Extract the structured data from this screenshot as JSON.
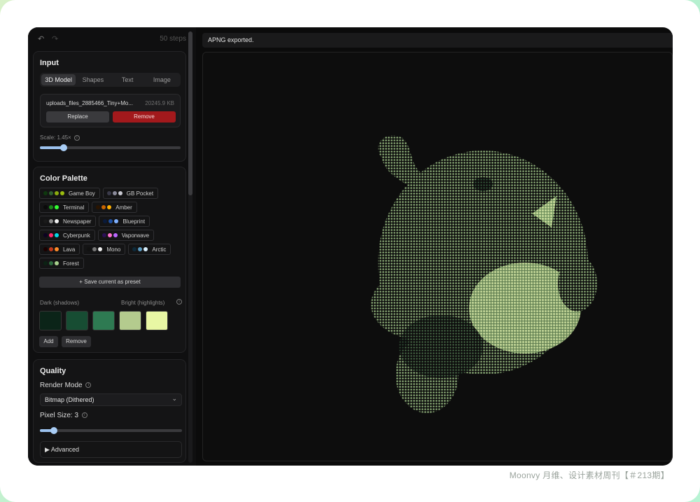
{
  "toolbar": {
    "undo": "↶",
    "redo": "↷",
    "steps": "50 steps"
  },
  "input": {
    "title": "Input",
    "tabs": [
      "3D Model",
      "Shapes",
      "Text",
      "Image"
    ],
    "file": {
      "name": "uploads_files_2885466_Tiny+Mo...",
      "size": "20245.9 KB"
    },
    "replace": "Replace",
    "remove": "Remove",
    "scale_label": "Scale: 1.45×",
    "scale_value": 0.17
  },
  "palette": {
    "title": "Color Palette",
    "presets": [
      {
        "name": "Game Boy",
        "colors": [
          "#0f380f",
          "#306230",
          "#8bac0f",
          "#9bbc0f"
        ]
      },
      {
        "name": "GB Pocket",
        "colors": [
          "#3a3a4a",
          "#8a8a9a",
          "#c8c8d0"
        ]
      },
      {
        "name": "Terminal",
        "colors": [
          "#0a0a0a",
          "#1a8a1a",
          "#33ff33"
        ]
      },
      {
        "name": "Amber",
        "colors": [
          "#2a1400",
          "#c86400",
          "#ffb000"
        ]
      },
      {
        "name": "Newspaper",
        "colors": [
          "#1a1a1a",
          "#8a8a8a",
          "#f0f0f0"
        ]
      },
      {
        "name": "Blueprint",
        "colors": [
          "#0a1a3a",
          "#1e4fa0",
          "#7fb0ff"
        ]
      },
      {
        "name": "Cyberpunk",
        "colors": [
          "#0d0221",
          "#ff2a6d",
          "#05d9e8"
        ]
      },
      {
        "name": "Vaporwave",
        "colors": [
          "#2b1055",
          "#ff71ce",
          "#b967ff"
        ]
      },
      {
        "name": "Lava",
        "colors": [
          "#1a0000",
          "#c0391b",
          "#ff8c2a"
        ]
      },
      {
        "name": "Mono",
        "colors": [
          "#111111",
          "#777777",
          "#eeeeee"
        ]
      },
      {
        "name": "Arctic",
        "colors": [
          "#0e2a3a",
          "#5a9ac0",
          "#d8f0ff"
        ]
      },
      {
        "name": "Forest",
        "colors": [
          "#0c2214",
          "#2e6b3e",
          "#a8d08d"
        ]
      }
    ],
    "save_preset": "+ Save current as preset",
    "dark_label": "Dark (shadows)",
    "bright_label": "Bright (highlights)",
    "swatches": [
      "#0b2418",
      "#174d33",
      "#2e7a52",
      "#b4cb8e",
      "#e8f7a4"
    ],
    "add": "Add",
    "remove": "Remove"
  },
  "quality": {
    "title": "Quality",
    "render_mode_label": "Render Mode",
    "render_mode_value": "Bitmap (Dithered)",
    "pixel_size_label": "Pixel Size: 3",
    "pixel_size_value": 0.1,
    "advanced": "▶ Advanced"
  },
  "status": "APNG exported.",
  "caption": "Moonvy 月维、设计素材周刊【＃213期】"
}
